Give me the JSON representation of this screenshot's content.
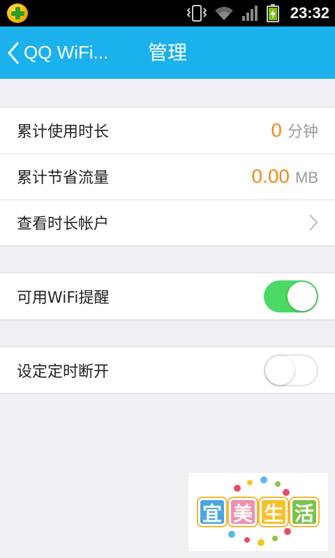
{
  "status_bar": {
    "time": "23:32"
  },
  "app_bar": {
    "back_label": "QQ WiFi...",
    "title": "管理"
  },
  "stats": [
    {
      "label": "累计使用时长",
      "value": "0",
      "unit": "分钟"
    },
    {
      "label": "累计节省流量",
      "value": "0.00",
      "unit": "MB"
    },
    {
      "label": "查看时长帐户"
    }
  ],
  "settings": {
    "wifi_reminder": {
      "label": "可用WiFi提醒",
      "enabled": true
    },
    "timed_disconnect": {
      "label": "设定定时断开",
      "enabled": false
    }
  },
  "watermark": {
    "chars": [
      "宜",
      "美",
      "生",
      "活"
    ]
  },
  "colors": {
    "accent": "#1ab1ec",
    "value": "#f08a1c",
    "toggle_on": "#4cd864"
  }
}
